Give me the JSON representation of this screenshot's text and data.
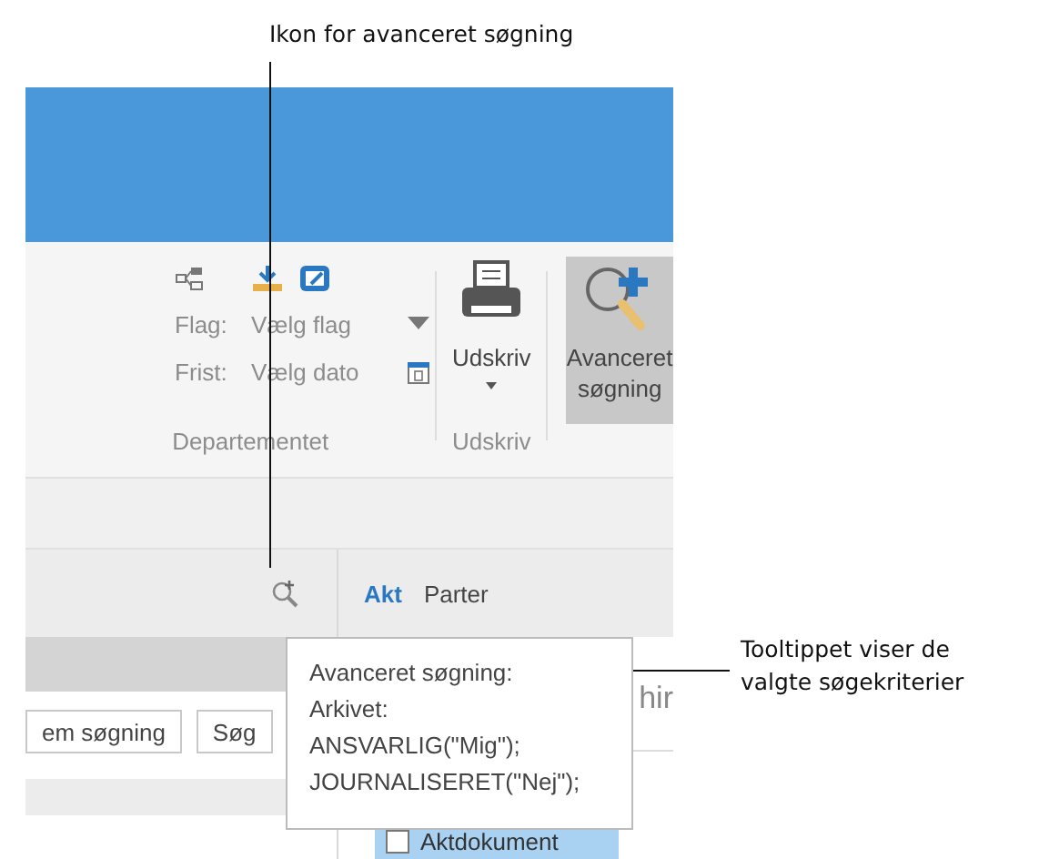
{
  "annotations": [
    {
      "text": "Ikon for avanceret søgning"
    },
    {
      "text": "Tooltippet viser de valgte søgekriterier"
    }
  ],
  "ribbon": {
    "groups": [
      {
        "label": "Departementet",
        "fields": [
          {
            "kind": "dropdown",
            "label": "Flag:",
            "value": "Vælg flag"
          },
          {
            "kind": "date",
            "label": "Frist:",
            "value": "Vælg dato"
          }
        ]
      },
      {
        "label": "Udskriv",
        "button": "Udskriv"
      }
    ],
    "advanced_search_button": {
      "label": "Avanceret søgning",
      "selected": true
    }
  },
  "tabs": [
    {
      "label": "Akt",
      "selected": true
    },
    {
      "label": "Parter",
      "selected": false
    }
  ],
  "buttons": [
    "em søgning",
    "Søg"
  ],
  "heading_fragment": "hir",
  "list": [
    {
      "label": "Aktdokument",
      "checked": false,
      "selected": true
    }
  ],
  "tooltip": {
    "lines": [
      "Avanceret søgning:",
      "Arkivet:",
      "ANSVARLIG(\"Mig\");",
      "JOURNALISERET(\"Nej\");"
    ]
  }
}
